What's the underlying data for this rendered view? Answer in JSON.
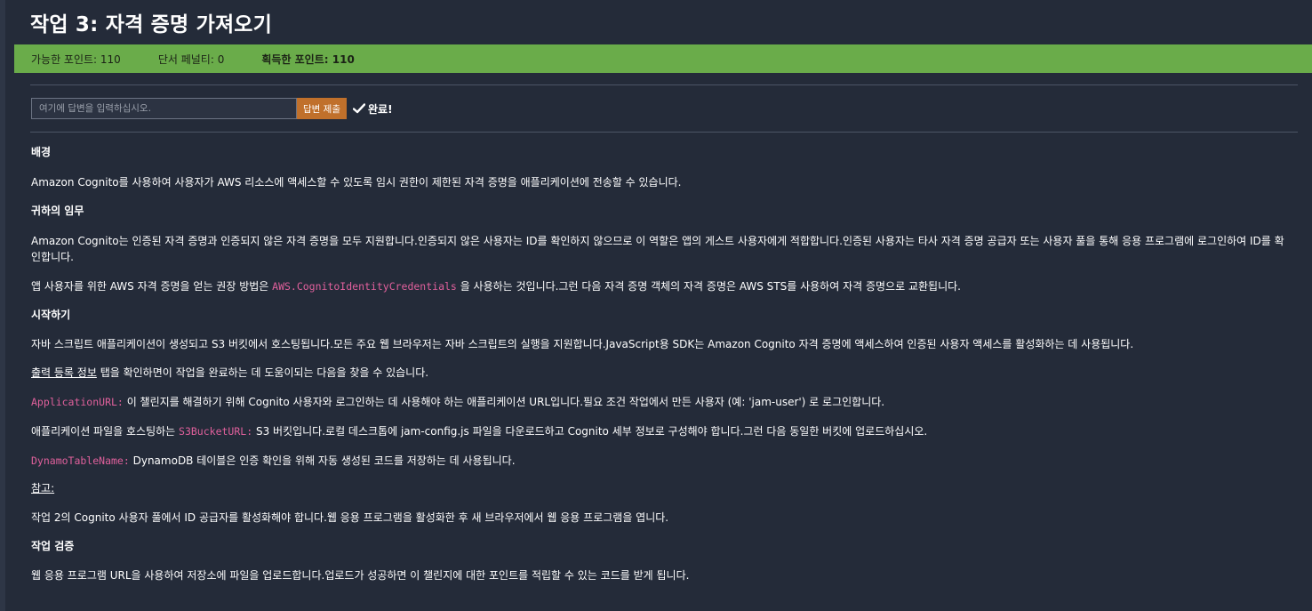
{
  "task": {
    "title": "작업 3: 자격 증명 가져오기"
  },
  "points": {
    "available": "가능한 포인트: 110",
    "penalty": "단서 페널티: 0",
    "earned": "획득한 포인트: 110"
  },
  "answer": {
    "placeholder": "여기에 답변을 입력하십시오.",
    "submit_label": "답변 제출",
    "status_label": "완료!"
  },
  "content": {
    "background_heading": "배경",
    "background_text": "Amazon Cognito를 사용하여 사용자가 AWS 리소스에 액세스할 수 있도록 임시 권한이 제한된 자격 증명을 애플리케이션에 전송할 수 있습니다.",
    "mission_heading": "귀하의 임무",
    "mission_text": "Amazon Cognito는 인증된 자격 증명과 인증되지 않은 자격 증명을 모두 지원합니다.인증되지 않은 사용자는 ID를 확인하지 않으므로 이 역할은 앱의 게스트 사용자에게 적합합니다.인증된 사용자는 타사 자격 증명 공급자 또는 사용자 풀을 통해 응용 프로그램에 로그인하여 ID를 확인합니다.",
    "recommend_pre": "앱 사용자를 위한 AWS 자격 증명을 얻는 권장 방법은",
    "recommend_code": "AWS.CognitoIdentityCredentials",
    "recommend_post": "을 사용하는 것입니다.그런 다음 자격 증명 객체의 자격 증명은 AWS STS를 사용하여 자격 증명으로 교환됩니다.",
    "start_heading": "시작하기",
    "start_text": "자바 스크립트 애플리케이션이 생성되고 S3 버킷에서 호스팅됩니다.모든 주요 웹 브라우저는 자바 스크립트의 실행을 지원합니다.JavaScript용 SDK는 Amazon Cognito 자격 증명에 액세스하여 인증된 사용자 액세스를 활성화하는 데 사용됩니다.",
    "outputs_link": "출력 등록 정보",
    "outputs_text": "탭을 확인하면이 작업을 완료하는 데 도움이되는 다음을 찾을 수 있습니다.",
    "app_url_code": "ApplicationURL:",
    "app_url_text": "이 챌린지를 해결하기 위해 Cognito 사용자와 로그인하는 데 사용해야 하는 애플리케이션 URL입니다.필요 조건 작업에서 만든 사용자 (예: 'jam-user') 로 로그인합니다.",
    "s3_pre": "애플리케이션 파일을 호스팅하는",
    "s3_code": "S3BucketURL:",
    "s3_post": "S3 버킷입니다.로컬 데스크톱에 jam-config.js 파일을 다운로드하고 Cognito 세부 정보로 구성해야 합니다.그런 다음 동일한 버킷에 업로드하십시오.",
    "dynamo_code": "DynamoTableName:",
    "dynamo_text": "DynamoDB 테이블은 인증 확인을 위해 자동 생성된 코드를 저장하는 데 사용됩니다.",
    "note_heading": "참고:",
    "note_text": "작업 2의 Cognito 사용자 풀에서 ID 공급자를 활성화해야 합니다.웹 응용 프로그램을 활성화한 후 새 브라우저에서 웹 응용 프로그램을 엽니다.",
    "verify_heading": "작업 검증",
    "verify_text": "웹 응용 프로그램 URL을 사용하여 저장소에 파일을 업로드합니다.업로드가 성공하면 이 챌린지에 대한 포인트를 적립할 수 있는 코드를 받게 됩니다."
  },
  "colors": {
    "points_bar": "#6aac4a",
    "submit_button": "#c0702b",
    "code_text": "#e0609c",
    "background": "#242b39"
  }
}
